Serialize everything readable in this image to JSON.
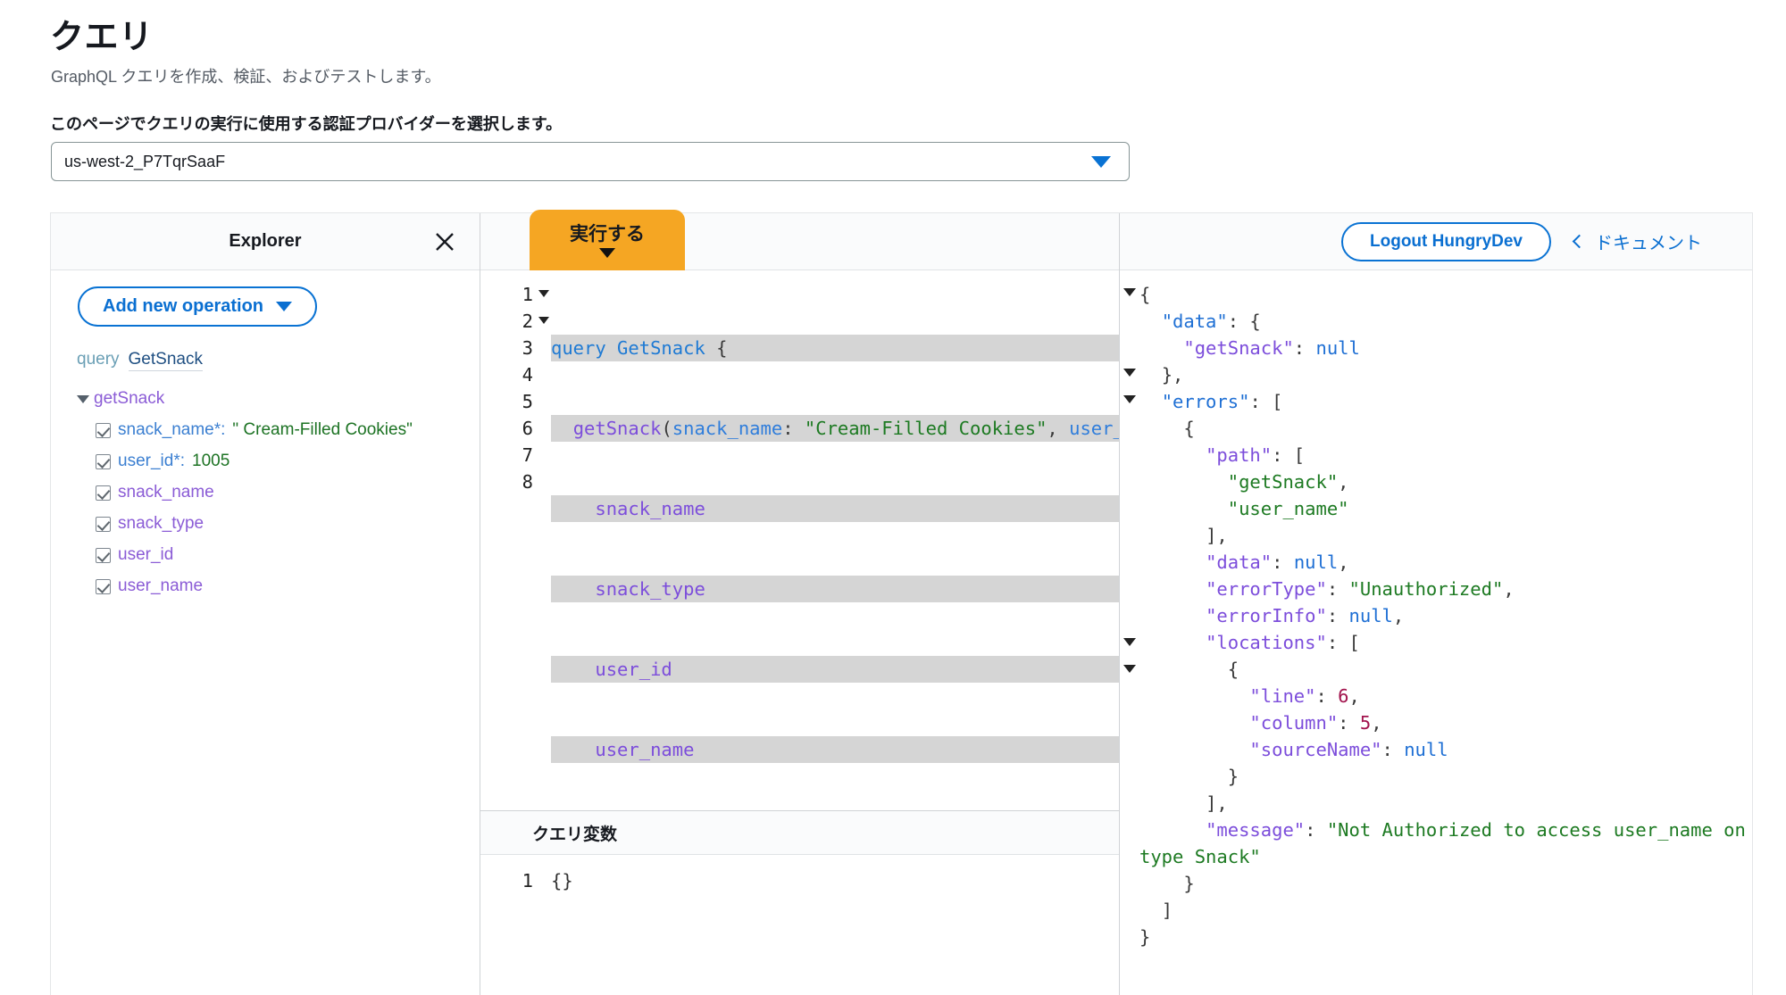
{
  "header": {
    "title": "クエリ",
    "subtitle": "GraphQL クエリを作成、検証、およびテストします。",
    "auth_label": "このページでクエリの実行に使用する認証プロバイダーを選択します。",
    "auth_value": "us-west-2_P7TqrSaaF",
    "caret_icon": "chevron-down-icon"
  },
  "explorer": {
    "title": "Explorer",
    "close_icon": "close-icon",
    "add_operation_label": "Add new operation",
    "operation_keyword": "query",
    "operation_name": "GetSnack",
    "root_field": "getSnack",
    "args": [
      {
        "name": "snack_name*:",
        "value": "\" Cream-Filled Cookies\"",
        "checked": true
      },
      {
        "name": "user_id*:",
        "value": "1005",
        "checked": true
      }
    ],
    "fields": [
      {
        "name": "snack_name",
        "checked": true
      },
      {
        "name": "snack_type",
        "checked": true
      },
      {
        "name": "user_id",
        "checked": true
      },
      {
        "name": "user_name",
        "checked": true
      }
    ]
  },
  "query_pane": {
    "execute_label": "実行する",
    "execute_color": "#f5a623",
    "line_numbers": [
      "1",
      "2",
      "3",
      "4",
      "5",
      "6",
      "7",
      "8"
    ],
    "fold_lines": [
      "1",
      "2"
    ],
    "code_lines": [
      "query GetSnack {",
      "  getSnack(snack_name: \"Cream-Filled Cookies\", user_",
      "    snack_name",
      "    snack_type",
      "    user_id",
      "    user_name",
      "  }",
      "}"
    ],
    "variables_title": "クエリ変数",
    "variables_line_number": "1",
    "variables_value": "{}"
  },
  "result_pane": {
    "logout_label": "Logout HungryDev",
    "docs_label": "ドキュメント",
    "docs_chevron_icon": "chevron-left-icon",
    "response": {
      "data": {
        "getSnack": null
      },
      "errors": [
        {
          "path": [
            "getSnack",
            "user_name"
          ],
          "data": null,
          "errorType": "Unauthorized",
          "errorInfo": null,
          "locations": [
            {
              "line": 6,
              "column": 5,
              "sourceName": null
            }
          ],
          "message": "Not Authorized to access user_name on type Snack"
        }
      ]
    }
  }
}
